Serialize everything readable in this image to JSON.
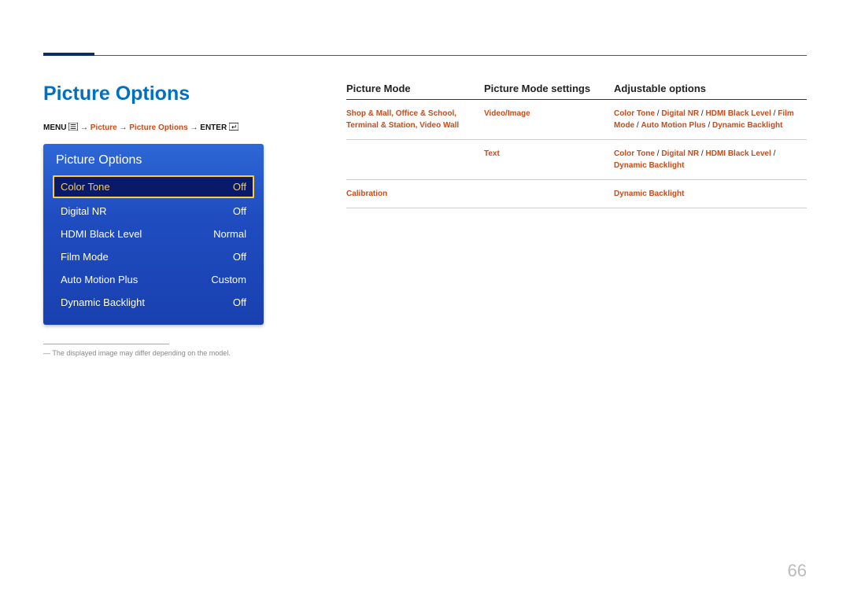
{
  "page_number": "66",
  "section_title": "Picture Options",
  "breadcrumb": {
    "menu": "MENU",
    "arrow": "→",
    "p1": "Picture",
    "p2": "Picture Options",
    "enter": "ENTER"
  },
  "osd": {
    "title": "Picture Options",
    "rows": [
      {
        "label": "Color Tone",
        "value": "Off",
        "selected": true
      },
      {
        "label": "Digital NR",
        "value": "Off",
        "selected": false
      },
      {
        "label": "HDMI Black Level",
        "value": "Normal",
        "selected": false
      },
      {
        "label": "Film Mode",
        "value": "Off",
        "selected": false
      },
      {
        "label": "Auto Motion Plus",
        "value": "Custom",
        "selected": false
      },
      {
        "label": "Dynamic Backlight",
        "value": "Off",
        "selected": false
      }
    ]
  },
  "footnote": "― The displayed image may differ depending on the model.",
  "table": {
    "headers": {
      "c1": "Picture Mode",
      "c2": "Picture Mode settings",
      "c3": "Adjustable options"
    },
    "rows": [
      {
        "c1": "Shop & Mall, Office & School, Terminal & Station, Video Wall",
        "c2": "Video/Image",
        "c3_parts": [
          "Color Tone",
          " / ",
          "Digital NR",
          " / ",
          "HDMI Black Level",
          " / ",
          "Film Mode",
          " / ",
          "Auto Motion Plus",
          " / ",
          "Dynamic Backlight"
        ],
        "c3_bold_idx": [
          6,
          8
        ]
      },
      {
        "c1": "",
        "c2": "Text",
        "c3_parts": [
          "Color Tone",
          " / ",
          "Digital NR",
          " / ",
          "HDMI Black Level",
          " / ",
          "Dynamic Backlight"
        ],
        "c3_bold_idx": []
      },
      {
        "c1": "Calibration",
        "c2": "",
        "c3_parts": [
          "Dynamic Backlight"
        ],
        "c3_bold_idx": []
      }
    ]
  }
}
